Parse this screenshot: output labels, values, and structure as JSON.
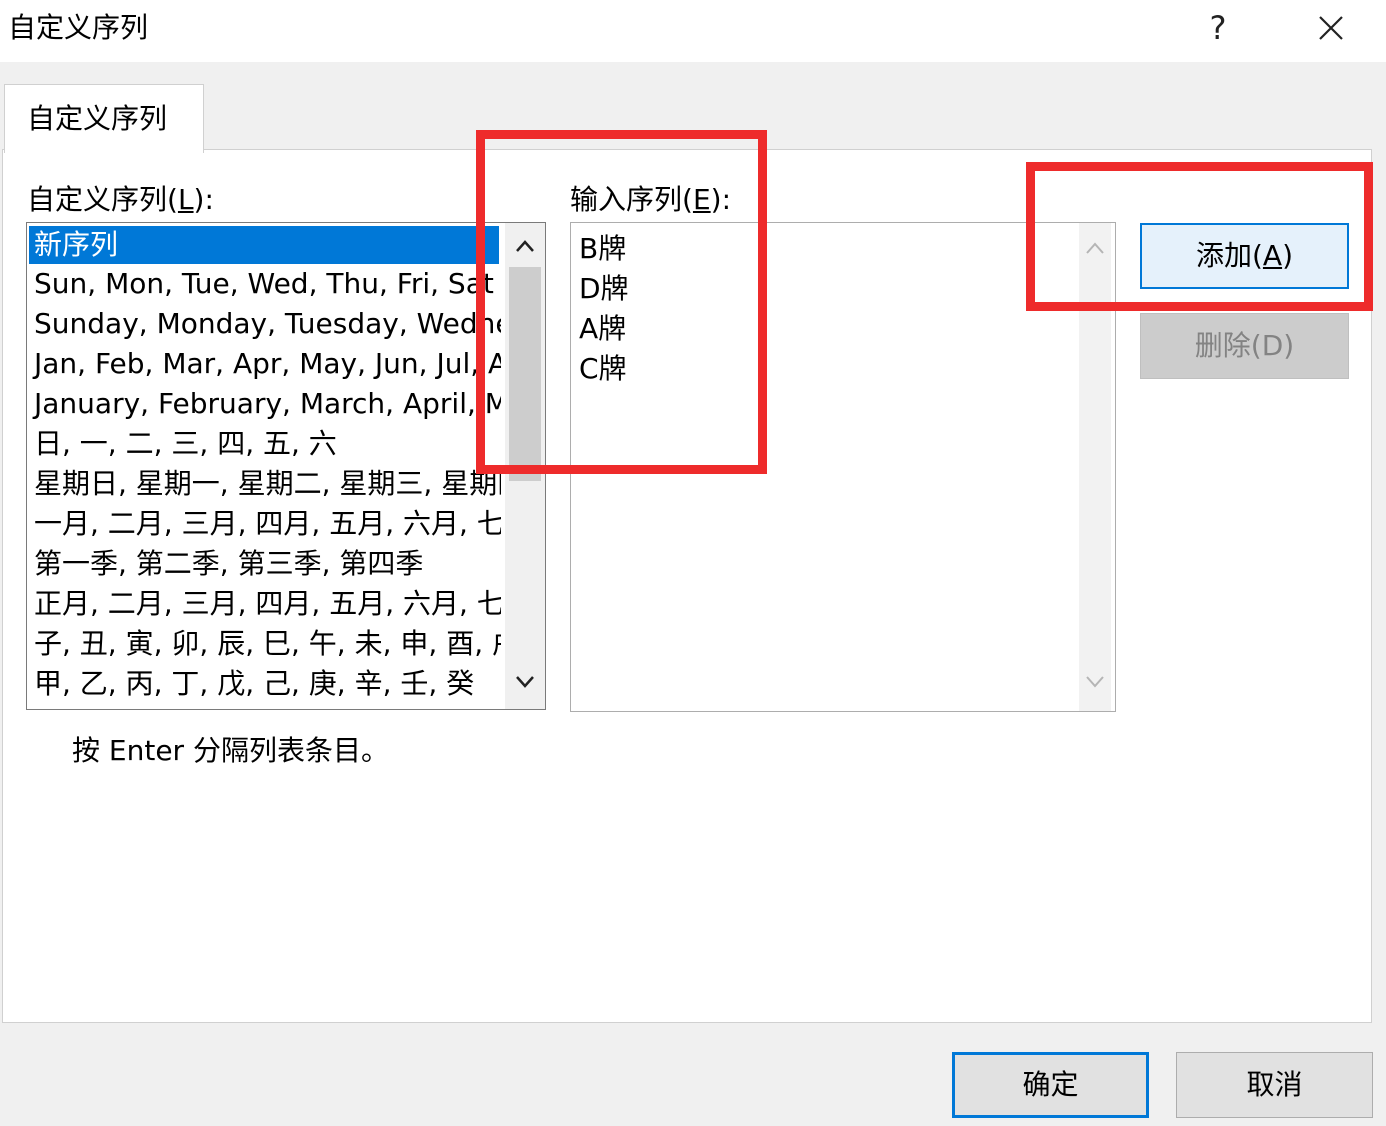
{
  "window": {
    "title": "自定义序列",
    "help_label": "?"
  },
  "tab": {
    "label": "自定义序列"
  },
  "custom_lists": {
    "label_prefix": "自定义序列(",
    "label_key": "L",
    "label_suffix": "):",
    "items": [
      "新序列",
      "Sun, Mon, Tue, Wed, Thu, Fri, Sat",
      "Sunday, Monday, Tuesday, Wednesday",
      "Jan, Feb, Mar, Apr, May, Jun, Jul, Aug",
      "January, February, March, April, May",
      "日, 一, 二, 三, 四, 五, 六",
      "星期日, 星期一, 星期二, 星期三, 星期四",
      "一月, 二月, 三月, 四月, 五月, 六月, 七月",
      "第一季, 第二季, 第三季, 第四季",
      "正月, 二月, 三月, 四月, 五月, 六月, 七月",
      "子, 丑, 寅, 卯, 辰, 巳, 午, 未, 申, 酉, 戌",
      "甲, 乙, 丙, 丁, 戊, 己, 庚, 辛, 壬, 癸"
    ],
    "selected_index": 0
  },
  "entries": {
    "label_prefix": "输入序列(",
    "label_key": "E",
    "label_suffix": "):",
    "lines": [
      "B牌",
      "D牌",
      "A牌",
      "C牌"
    ]
  },
  "buttons": {
    "add_prefix": "添加(",
    "add_key": "A",
    "add_suffix": ")",
    "delete_label": "删除(D)",
    "ok_label": "确定",
    "cancel_label": "取消"
  },
  "hint": "按 Enter 分隔列表条目。",
  "colors": {
    "selection": "#0078d7",
    "highlight": "#ee2b2b"
  }
}
